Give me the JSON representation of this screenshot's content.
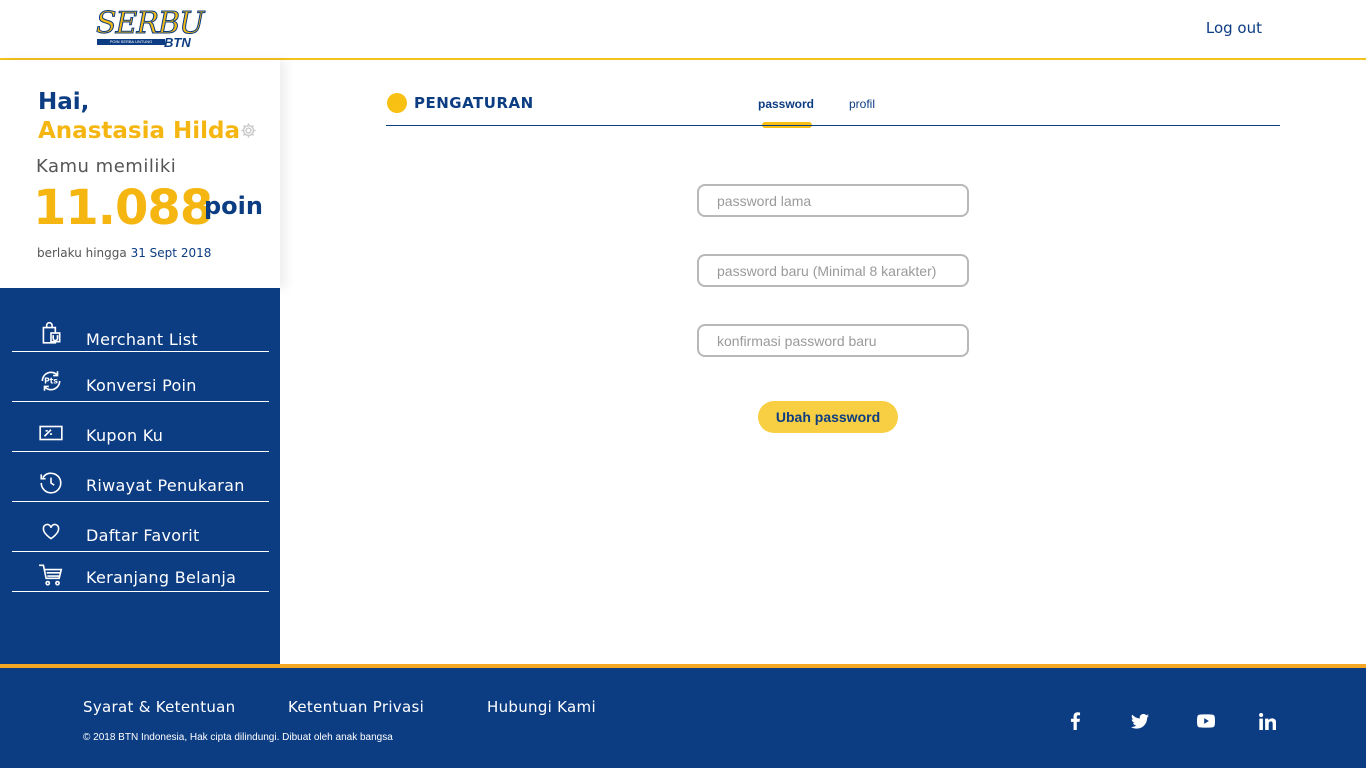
{
  "header": {
    "logo_main": "SERBU",
    "logo_tagline": "POIN SERBA UNTUNG",
    "logo_sub": "BTN",
    "logout_label": "Log out"
  },
  "profile": {
    "greeting": "Hai,",
    "name": "Anastasia Hilda",
    "have_label": "Kamu memiliki",
    "points": "11.088",
    "points_unit": "poin",
    "valid_label": "berlaku hingga",
    "valid_date": "31 Sept 2018"
  },
  "sidebar": {
    "items": [
      {
        "label": "Merchant List",
        "icon": "shopping-bag-icon"
      },
      {
        "label": "Konversi Poin",
        "icon": "points-convert-icon"
      },
      {
        "label": "Kupon Ku",
        "icon": "coupon-icon"
      },
      {
        "label": "Riwayat Penukaran",
        "icon": "history-icon"
      },
      {
        "label": "Daftar Favorit",
        "icon": "heart-icon"
      },
      {
        "label": "Keranjang Belanja",
        "icon": "cart-icon"
      }
    ]
  },
  "main": {
    "title": "PENGATURAN",
    "tabs": [
      {
        "label": "password",
        "active": true
      },
      {
        "label": "profil",
        "active": false
      }
    ],
    "form": {
      "old_password_placeholder": "password lama",
      "new_password_placeholder": "password baru (Minimal 8 karakter)",
      "confirm_password_placeholder": "konfirmasi password baru",
      "submit_label": "Ubah password"
    }
  },
  "footer": {
    "links": [
      "Syarat & Ketentuan",
      "Ketentuan Privasi",
      "Hubungi Kami"
    ],
    "copyright": "© 2018 BTN Indonesia, Hak cipta dilindungi. Dibuat oleh anak bangsa",
    "social": [
      "facebook-icon",
      "twitter-icon",
      "youtube-icon",
      "linkedin-icon"
    ]
  },
  "colors": {
    "primary_blue": "#0c3c82",
    "accent_yellow": "#f5b612",
    "footer_border": "#f5a623"
  }
}
